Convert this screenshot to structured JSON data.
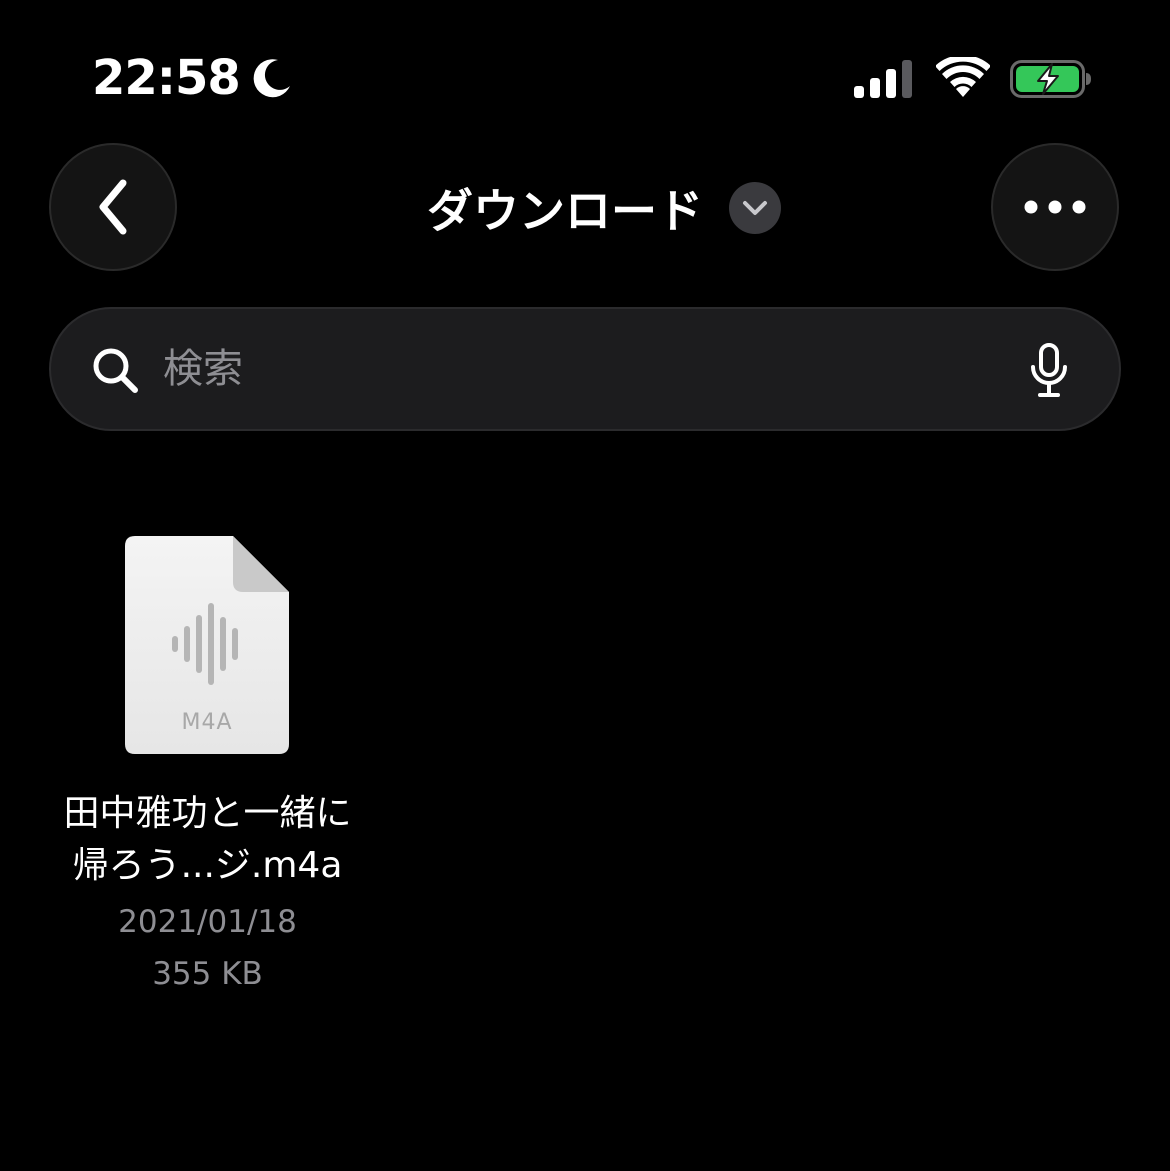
{
  "status_bar": {
    "time": "22:58",
    "focus_icon": "moon-icon",
    "signal_icon": "cellular-signal-icon",
    "wifi_icon": "wifi-icon",
    "battery_icon": "battery-charging-icon",
    "battery_color": "#34c759"
  },
  "nav": {
    "title": "ダウンロード",
    "back_icon": "chevron-left-icon",
    "title_menu_icon": "chevron-down-icon",
    "more_icon": "ellipsis-icon"
  },
  "search": {
    "placeholder": "検索",
    "value": "",
    "search_icon": "magnifying-glass-icon",
    "mic_icon": "microphone-icon"
  },
  "files": [
    {
      "icon": "audio-file-icon",
      "extension": "M4A",
      "name_line1": "田中雅功と一緒に",
      "name_line2": "帰ろう...ジ.m4a",
      "date": "2021/01/18",
      "size": "355 KB"
    }
  ],
  "colors": {
    "background": "#000000",
    "button_fill": "#141414",
    "search_fill": "#1c1c1e",
    "secondary_text": "#8e8e93"
  }
}
